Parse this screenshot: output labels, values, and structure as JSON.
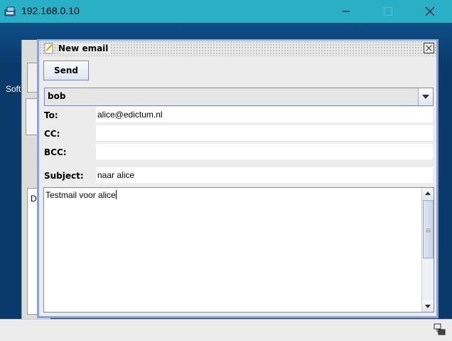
{
  "window": {
    "title": "192.168.0.10"
  },
  "desktop": {
    "label": "Soft",
    "bg_list_letter": "D"
  },
  "dialog": {
    "title": "New email",
    "send_label": "Send",
    "from_value": "bob",
    "fields": {
      "to_label": "To:",
      "to_value": "alice@edictum.nl",
      "cc_label": "CC:",
      "cc_value": "",
      "bcc_label": "BCC:",
      "bcc_value": "",
      "subject_label": "Subject:",
      "subject_value": "naar alice"
    },
    "body_text": "Testmail voor alice"
  },
  "colors": {
    "title_bar": "#2ab0c6",
    "dialog_border": "#8aa4d2",
    "desktop_bg": "#0a3a6b"
  },
  "icons": [
    "remote-desktop-app-icon",
    "minimize-icon",
    "maximize-icon",
    "close-icon",
    "note-pad-icon",
    "dropdown-arrow-icon",
    "scroll-up-icon",
    "scroll-down-icon",
    "network-status-icon"
  ]
}
